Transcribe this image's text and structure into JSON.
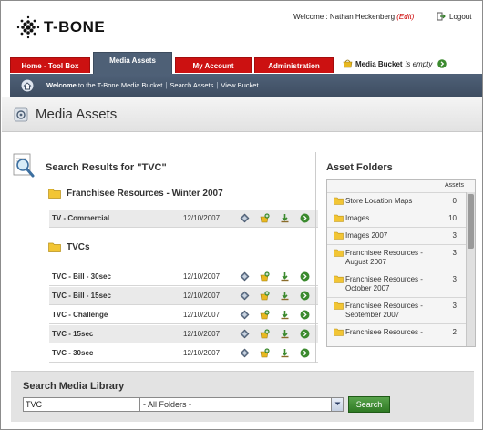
{
  "brand": {
    "logo_text": "T-BONE"
  },
  "header": {
    "welcome_label": "Welcome :",
    "user_name": "Nathan Heckenberg",
    "edit_label": "(Edit)",
    "logout_label": "Logout"
  },
  "tabs": [
    {
      "label": "Home - Tool Box",
      "active": false
    },
    {
      "label": "Media Assets",
      "active": true
    },
    {
      "label": "My Account",
      "active": false
    },
    {
      "label": "Administration",
      "active": false
    }
  ],
  "bucket": {
    "label": "Media Bucket",
    "status": "is empty"
  },
  "subnav": {
    "welcome_bold": "Welcome",
    "welcome_rest": " to the T-Bone Media Bucket",
    "search_assets": "Search Assets",
    "view_bucket": "View Bucket",
    "separator": "|"
  },
  "page": {
    "title": "Media Assets"
  },
  "results": {
    "title": "Search Results for \"TVC\"",
    "groups": [
      {
        "name": "Franchisee Resources - Winter 2007",
        "items": [
          {
            "name": "TV - Commercial",
            "date": "12/10/2007"
          }
        ]
      },
      {
        "name": "TVCs",
        "items": [
          {
            "name": "TVC - Bill - 30sec",
            "date": "12/10/2007"
          },
          {
            "name": "TVC - Bill - 15sec",
            "date": "12/10/2007"
          },
          {
            "name": "TVC - Challenge",
            "date": "12/10/2007"
          },
          {
            "name": "TVC - 15sec",
            "date": "12/10/2007"
          },
          {
            "name": "TVC - 30sec",
            "date": "12/10/2007"
          }
        ]
      }
    ]
  },
  "asset_folders": {
    "title": "Asset Folders",
    "column_header": "Assets",
    "folders": [
      {
        "name": "Store Location Maps",
        "count": "0"
      },
      {
        "name": "Images",
        "count": "10"
      },
      {
        "name": "Images 2007",
        "count": "3"
      },
      {
        "name": "Franchisee Resources - August 2007",
        "count": "3"
      },
      {
        "name": "Franchisee Resources - October 2007",
        "count": "3"
      },
      {
        "name": "Franchisee Resources - September 2007",
        "count": "3"
      },
      {
        "name": "Franchisee Resources -",
        "count": "2"
      }
    ]
  },
  "search": {
    "label": "Search Media Library",
    "query": "TVC",
    "folder_selected": "- All Folders -",
    "button": "Search"
  },
  "colors": {
    "tab_red": "#cc1111",
    "tab_active": "#4e6076",
    "accent_green": "#3b8a2e",
    "edit_red": "#cc0000"
  },
  "icons": {
    "row_actions": [
      "diamond-icon",
      "add-to-bucket-icon",
      "download-icon",
      "go-arrow-icon"
    ]
  }
}
